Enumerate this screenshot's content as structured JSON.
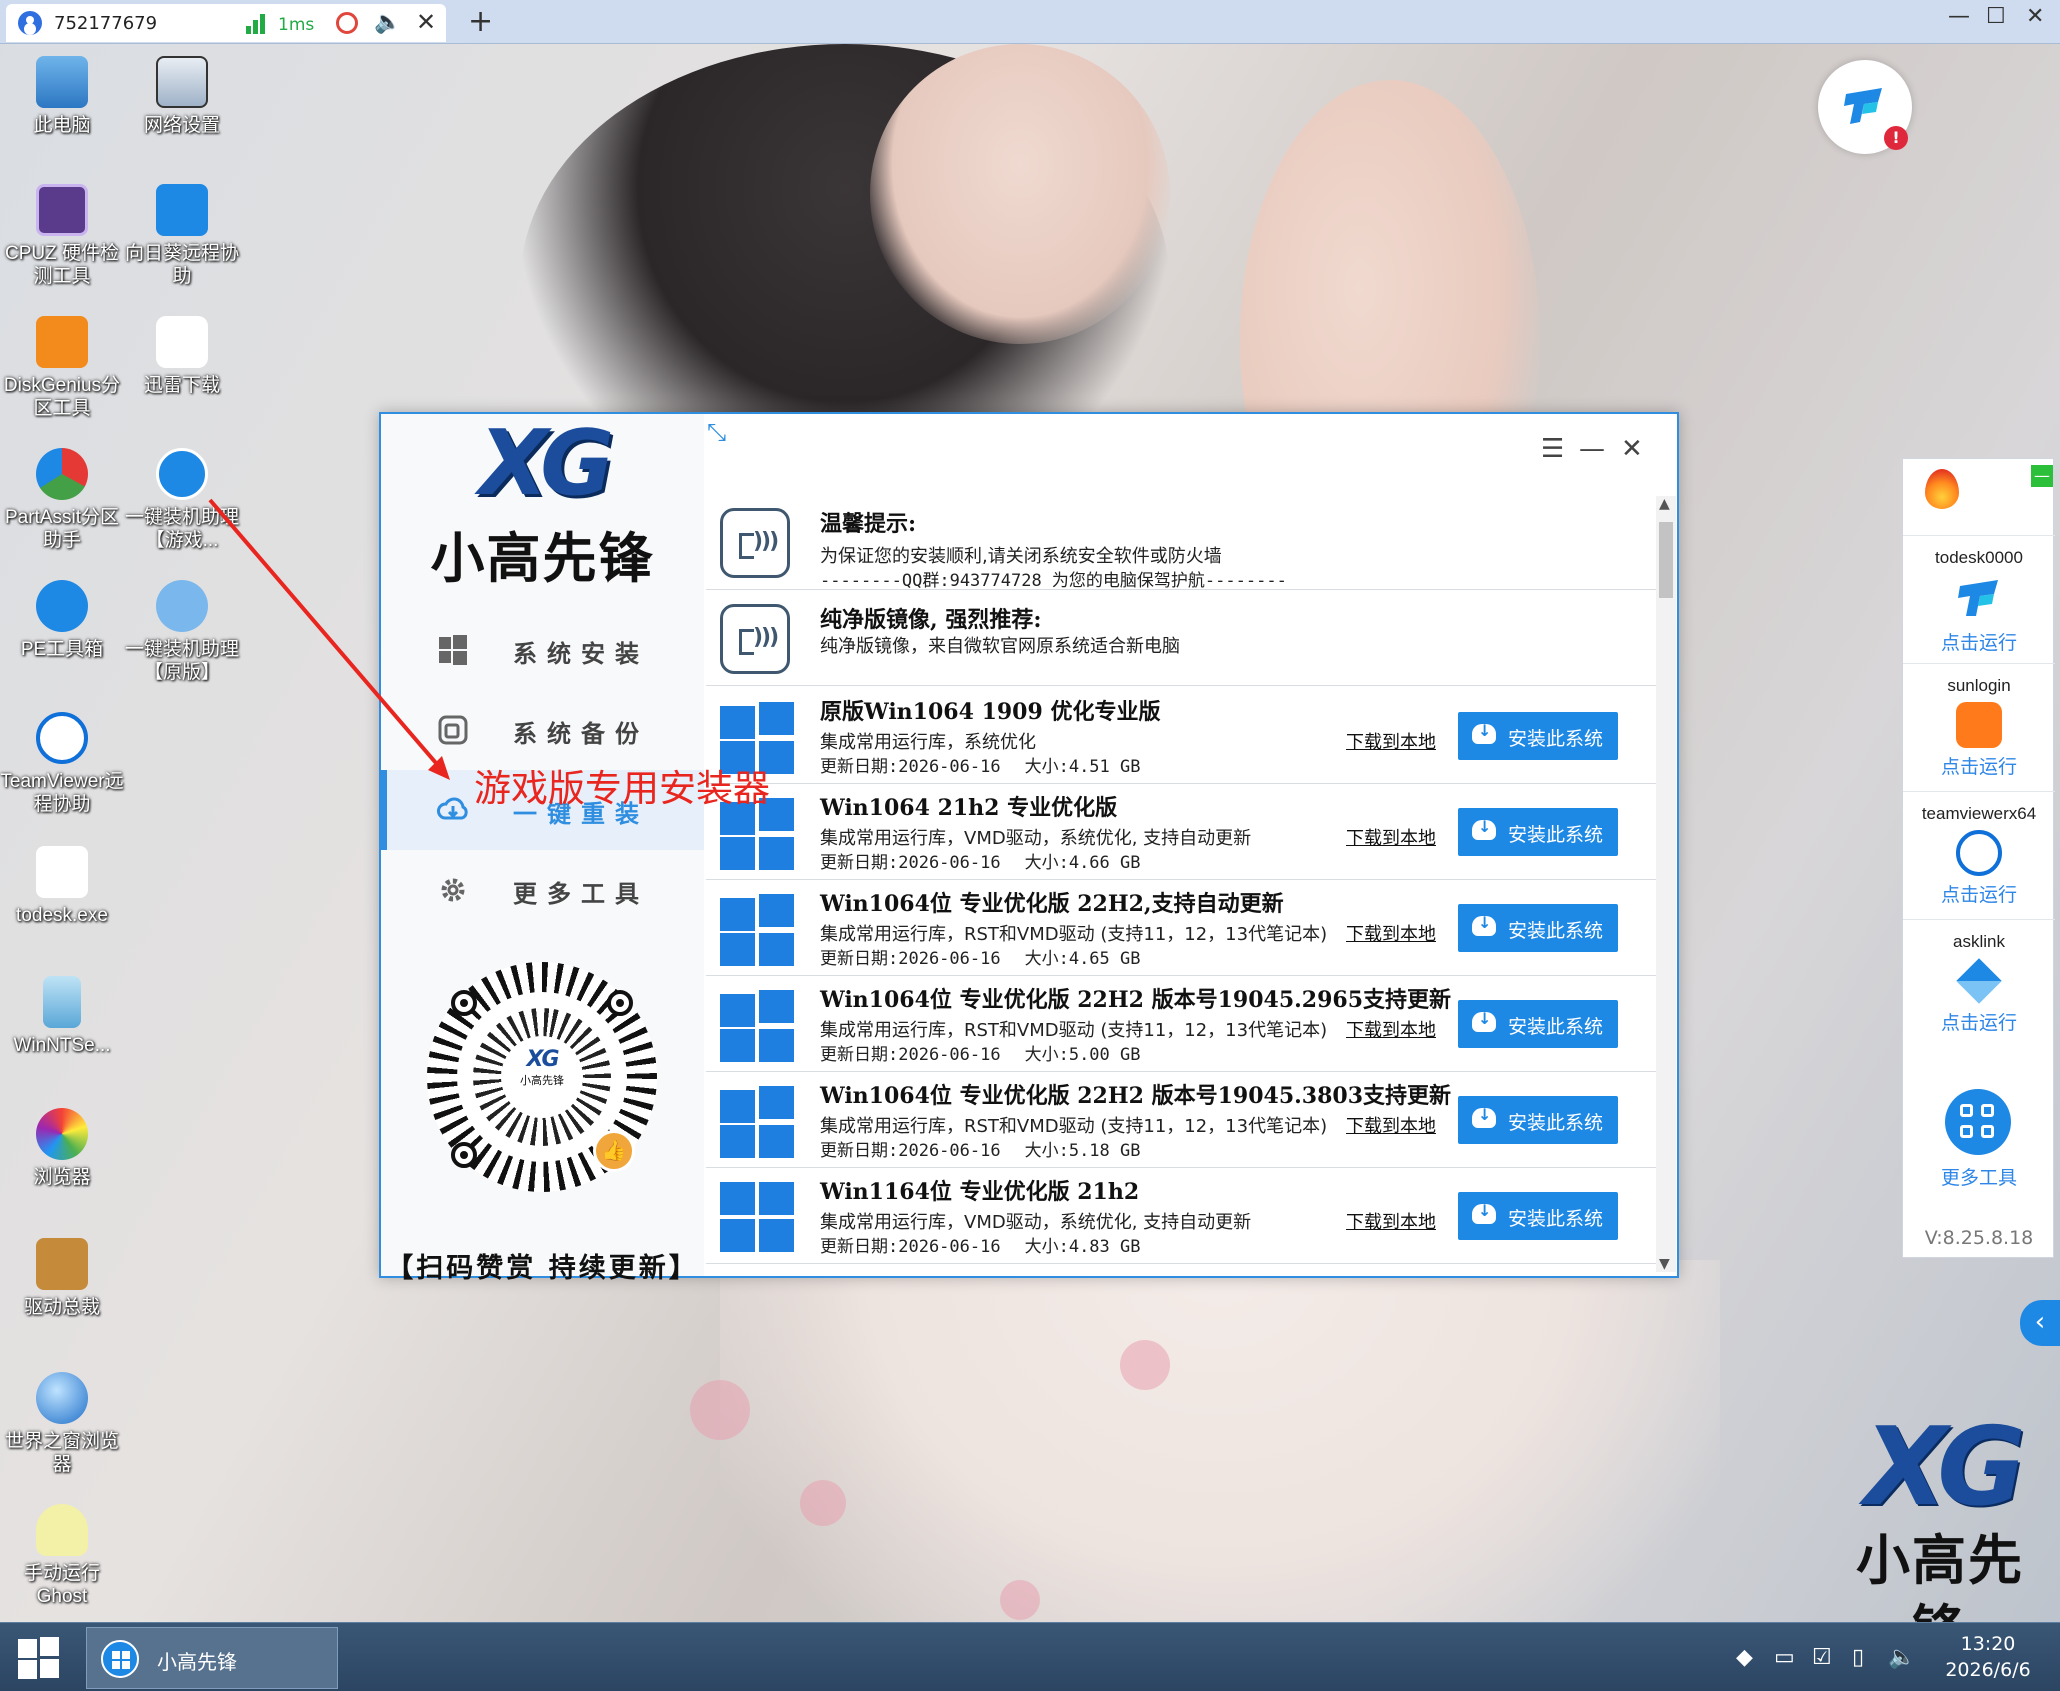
{
  "remote": {
    "session_id": "752177679",
    "latency": "1ms"
  },
  "desktop_icons": [
    {
      "label": "此电脑"
    },
    {
      "label": "网络设置"
    },
    {
      "label": "CPUZ 硬件检测工具"
    },
    {
      "label": "向日葵远程协助"
    },
    {
      "label": "DiskGenius分区工具"
    },
    {
      "label": "迅雷下载"
    },
    {
      "label": "PartAssit分区助手"
    },
    {
      "label": "一键装机助理【游戏..."
    },
    {
      "label": "PE工具箱"
    },
    {
      "label": "一键装机助理【原版】"
    },
    {
      "label": "TeamViewer远程协助"
    },
    {
      "label": "todesk.exe"
    },
    {
      "label": "WinNTSe..."
    },
    {
      "label": "浏览器"
    },
    {
      "label": "驱动总裁"
    },
    {
      "label": "世界之窗浏览器"
    },
    {
      "label": "手动运行Ghost"
    }
  ],
  "installer": {
    "logo_xg": "XG",
    "logo_cn": "小高先锋",
    "nav": [
      {
        "label": "系统安装"
      },
      {
        "label": "系统备份"
      },
      {
        "label": "一键重装"
      },
      {
        "label": "更多工具"
      }
    ],
    "qr_logo_xg": "XG",
    "qr_logo_cn": "小高先锋",
    "scan_caption": "【扫码赞赏 持续更新】",
    "notices": [
      {
        "title": "温馨提示:",
        "line1": "为保证您的安装顺利,请关闭系统安全软件或防火墙",
        "line2": "--------QQ群:943774728 为您的电脑保驾护航--------"
      },
      {
        "title": "纯净版镜像, 强烈推荐:",
        "line1": "纯净版镜像，来自微软官网原系统适合新电脑",
        "line2": ""
      }
    ],
    "systems": [
      {
        "name": "原版Win1064 1909 优化专业版",
        "desc": "集成常用运行库，系统优化",
        "date": "更新日期:2026-06-16",
        "size": "大小:4.51 GB",
        "download": "下载到本地",
        "install": "安装此系统"
      },
      {
        "name": "Win1064 21h2 专业优化版",
        "desc": "集成常用运行库，VMD驱动，系统优化, 支持自动更新",
        "date": "更新日期:2026-06-16",
        "size": "大小:4.66 GB",
        "download": "下载到本地",
        "install": "安装此系统"
      },
      {
        "name": "Win1064位 专业优化版 22H2,支持自动更新",
        "desc": "集成常用运行库，RST和VMD驱动 (支持11，12，13代笔记本)",
        "date": "更新日期:2026-06-16",
        "size": "大小:4.65 GB",
        "download": "下载到本地",
        "install": "安装此系统"
      },
      {
        "name": "Win1064位 专业优化版 22H2 版本号19045.2965支持更新",
        "desc": "集成常用运行库，RST和VMD驱动 (支持11，12，13代笔记本)",
        "date": "更新日期:2026-06-16",
        "size": "大小:5.00 GB",
        "download": "下载到本地",
        "install": "安装此系统"
      },
      {
        "name": "Win1064位 专业优化版 22H2 版本号19045.3803支持更新",
        "desc": "集成常用运行库，RST和VMD驱动 (支持11，12，13代笔记本)",
        "date": "更新日期:2026-06-16",
        "size": "大小:5.18 GB",
        "download": "下载到本地",
        "install": "安装此系统"
      },
      {
        "name": "Win1164位 专业优化版 21h2",
        "desc": "集成常用运行库，VMD驱动，系统优化, 支持自动更新",
        "date": "更新日期:2026-06-16",
        "size": "大小:4.83 GB",
        "download": "下载到本地",
        "install": "安装此系统"
      }
    ]
  },
  "annotation": "游戏版专用安装器",
  "side_panel": {
    "items": [
      {
        "name": "todesk0000",
        "run": "点击运行"
      },
      {
        "name": "sunlogin",
        "run": "点击运行"
      },
      {
        "name": "teamviewerx64",
        "run": "点击运行"
      },
      {
        "name": "asklink",
        "run": "点击运行"
      }
    ],
    "more": "更多工具",
    "version": "V:8.25.8.18"
  },
  "badge_alert": "!",
  "watermark": {
    "xg": "XG",
    "cn": "小高先锋"
  },
  "taskbar": {
    "task_label": "小高先锋",
    "time": "13:20",
    "date": "2026/6/6"
  },
  "colors": {
    "accent": "#1e88e5",
    "annotation": "#e8261f"
  }
}
